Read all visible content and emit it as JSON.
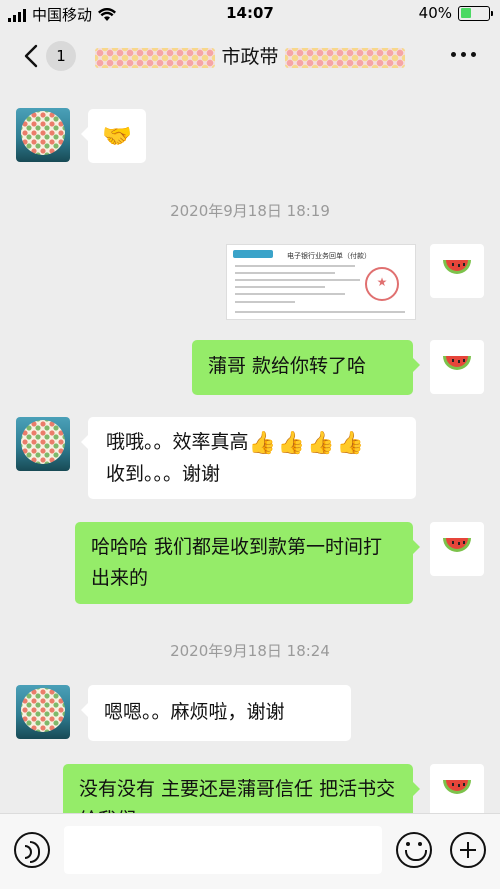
{
  "status_bar": {
    "carrier": "中国移动",
    "time": "14:07",
    "battery": "40%",
    "battery_level": 0.4
  },
  "header": {
    "unread_count": "1",
    "title_visible": "市政带"
  },
  "messages": [
    {
      "side": "in",
      "content": "handshake-emoji"
    },
    {
      "side": "timestamp",
      "text": "2020年9月18日 18:19"
    },
    {
      "side": "out",
      "content": "bank-receipt-image"
    },
    {
      "side": "out",
      "text": "蒲哥 款给你转了哈"
    },
    {
      "side": "in",
      "text": "哦哦。。效率真高",
      "text2": "收到。。。谢谢",
      "emoji": "👍👍👍👍"
    },
    {
      "side": "out",
      "text": "哈哈哈 我们都是收到款第一时间打出来的"
    },
    {
      "side": "timestamp",
      "text": "2020年9月18日 18:24"
    },
    {
      "side": "in",
      "text": "嗯嗯。。麻烦啦，谢谢"
    },
    {
      "side": "out",
      "text": "没有没有  主要还是蒲哥信任 把活书交给我们"
    }
  ],
  "receipt": {
    "title": "电子银行业务回单（付款）"
  },
  "input": {
    "value": ""
  },
  "colors": {
    "out_bubble": "#95ec69",
    "in_bubble": "#ffffff",
    "background": "#ededed"
  },
  "icons": [
    "back-icon",
    "more-icon",
    "voice-icon",
    "emoji-icon",
    "plus-icon",
    "handshake-emoji",
    "watermelon-avatar"
  ]
}
